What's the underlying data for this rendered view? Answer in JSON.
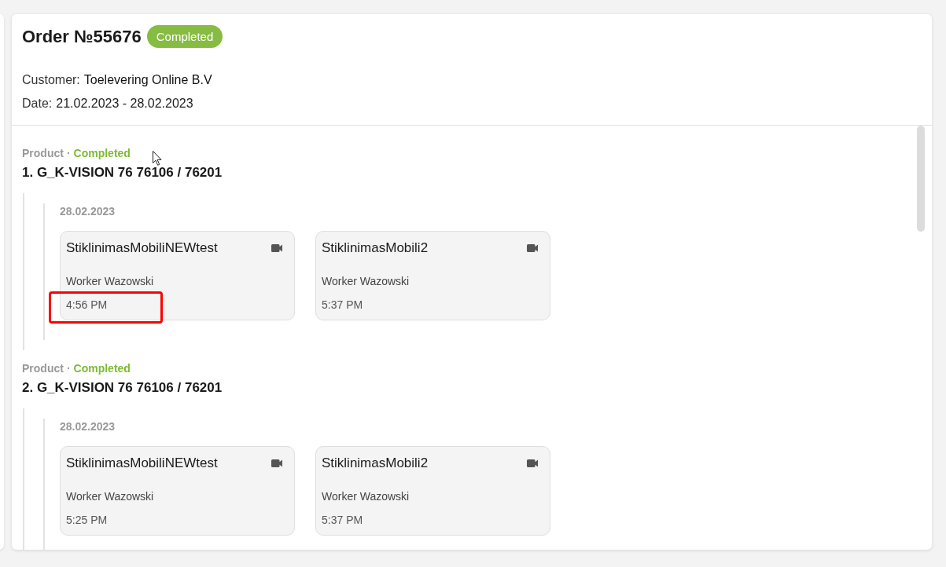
{
  "order": {
    "title": "Order №55676",
    "status": "Completed",
    "customer": {
      "label": "Customer:",
      "value": "Toelevering Online B.V"
    },
    "date": {
      "label": "Date:",
      "value": "21.02.2023 - 28.02.2023"
    }
  },
  "products": [
    {
      "type_label": "Product",
      "separator": "·",
      "status": "Completed",
      "name": "1. G_K-VISION 76 76106 / 76201",
      "days": [
        {
          "date": "28.02.2023",
          "events": [
            {
              "title": "StiklinimasMobiliNEWtest",
              "worker": "Worker Wazowski",
              "time": "4:56 PM",
              "highlighted": true
            },
            {
              "title": "StiklinimasMobili2",
              "worker": "Worker Wazowski",
              "time": "5:37 PM",
              "highlighted": false
            }
          ]
        }
      ]
    },
    {
      "type_label": "Product",
      "separator": "·",
      "status": "Completed",
      "name": "2. G_K-VISION 76 76106 / 76201",
      "days": [
        {
          "date": "28.02.2023",
          "events": [
            {
              "title": "StiklinimasMobiliNEWtest",
              "worker": "Worker Wazowski",
              "time": "5:25 PM",
              "highlighted": false
            },
            {
              "title": "StiklinimasMobili2",
              "worker": "Worker Wazowski",
              "time": "5:37 PM",
              "highlighted": false
            }
          ]
        }
      ]
    }
  ]
}
